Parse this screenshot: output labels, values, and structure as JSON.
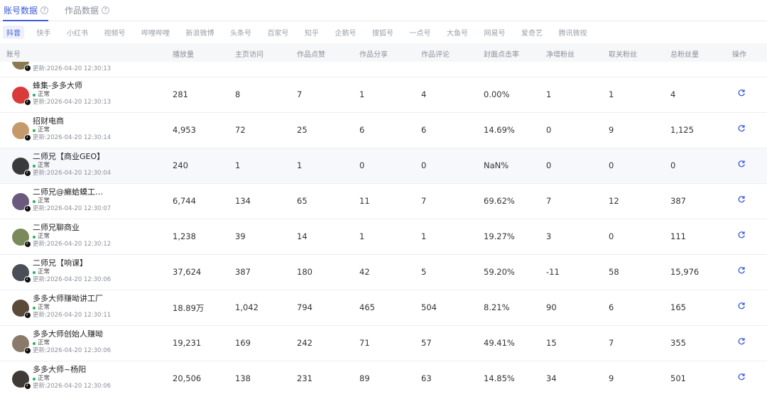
{
  "top_tabs": [
    {
      "label": "账号数据",
      "active": true
    },
    {
      "label": "作品数据",
      "active": false
    }
  ],
  "platforms": [
    "抖音",
    "快手",
    "小红书",
    "视频号",
    "哔哩哔哩",
    "新浪微博",
    "头条号",
    "百家号",
    "知乎",
    "企鹅号",
    "搜狐号",
    "一点号",
    "大鱼号",
    "网易号",
    "爱奇艺",
    "腾讯微视"
  ],
  "active_platform": "抖音",
  "columns": [
    "账号",
    "播放量",
    "主页访问",
    "作品点赞",
    "作品分享",
    "作品评论",
    "封面点击率",
    "净增粉丝",
    "取关粉丝",
    "总粉丝量",
    "操作"
  ],
  "partial_row": {
    "updated": "更新:2026-04-20 12:30:13"
  },
  "rows": [
    {
      "name": "蜂集-多多大师",
      "status": "正常",
      "updated": "更新:2026-04-20 12:30:13",
      "plays": "281",
      "visits": "8",
      "likes": "7",
      "shares": "1",
      "comments": "4",
      "ctr": "0.00%",
      "net_fans": "1",
      "unfollows": "1",
      "total_fans": "4",
      "avatar_color": "#d93a3a"
    },
    {
      "name": "招财电商",
      "status": "正常",
      "updated": "更新:2026-04-20 12:30:14",
      "plays": "4,953",
      "visits": "72",
      "likes": "25",
      "shares": "6",
      "comments": "6",
      "ctr": "14.69%",
      "net_fans": "0",
      "unfollows": "9",
      "total_fans": "1,125",
      "avatar_color": "#c49a6c"
    },
    {
      "name": "二师兄【商业GEO】",
      "status": "正常",
      "updated": "更新:2026-04-20 12:30:04",
      "plays": "240",
      "visits": "1",
      "likes": "1",
      "shares": "0",
      "comments": "0",
      "ctr": "NaN%",
      "net_fans": "0",
      "unfollows": "0",
      "total_fans": "0",
      "avatar_color": "#3a3a3a",
      "highlight": true
    },
    {
      "name": "二师兄@癞蛤蟆工…",
      "status": "正常",
      "updated": "更新:2026-04-20 12:30:07",
      "plays": "6,744",
      "visits": "134",
      "likes": "65",
      "shares": "11",
      "comments": "7",
      "ctr": "69.62%",
      "net_fans": "7",
      "unfollows": "12",
      "total_fans": "387",
      "avatar_color": "#6b5a7e"
    },
    {
      "name": "二师兄聊商业",
      "status": "正常",
      "updated": "更新:2026-04-20 12:30:12",
      "plays": "1,238",
      "visits": "39",
      "likes": "14",
      "shares": "1",
      "comments": "1",
      "ctr": "19.27%",
      "net_fans": "3",
      "unfollows": "0",
      "total_fans": "111",
      "avatar_color": "#7a8a5a"
    },
    {
      "name": "二师兄【响课】",
      "status": "正常",
      "updated": "更新:2026-04-20 12:30:06",
      "plays": "37,624",
      "visits": "387",
      "likes": "180",
      "shares": "42",
      "comments": "5",
      "ctr": "59.20%",
      "net_fans": "-11",
      "unfollows": "58",
      "total_fans": "15,976",
      "avatar_color": "#4a4f57"
    },
    {
      "name": "多多大师赚呦讲工厂",
      "status": "正常",
      "updated": "更新:2026-04-20 12:30:11",
      "plays": "18.89万",
      "visits": "1,042",
      "likes": "794",
      "shares": "465",
      "comments": "504",
      "ctr": "8.21%",
      "net_fans": "90",
      "unfollows": "6",
      "total_fans": "165",
      "avatar_color": "#5a4a3a"
    },
    {
      "name": "多多大师创始人赚呦",
      "status": "正常",
      "updated": "更新:2026-04-20 12:30:06",
      "plays": "19,231",
      "visits": "169",
      "likes": "242",
      "shares": "71",
      "comments": "57",
      "ctr": "49.41%",
      "net_fans": "15",
      "unfollows": "7",
      "total_fans": "355",
      "avatar_color": "#8a7a6a"
    },
    {
      "name": "多多大师~杨阳",
      "status": "正常",
      "updated": "更新:2026-04-20 12:30:06",
      "plays": "20,506",
      "visits": "138",
      "likes": "231",
      "shares": "89",
      "comments": "63",
      "ctr": "14.85%",
      "net_fans": "34",
      "unfollows": "9",
      "total_fans": "501",
      "avatar_color": "#3f3a36"
    }
  ],
  "colors": {
    "accent": "#3b5bdb",
    "status_ok": "#22b35e"
  },
  "icons": {
    "refresh": "refresh-icon",
    "help": "question-icon",
    "platform_badge": "douyin-badge-icon"
  }
}
